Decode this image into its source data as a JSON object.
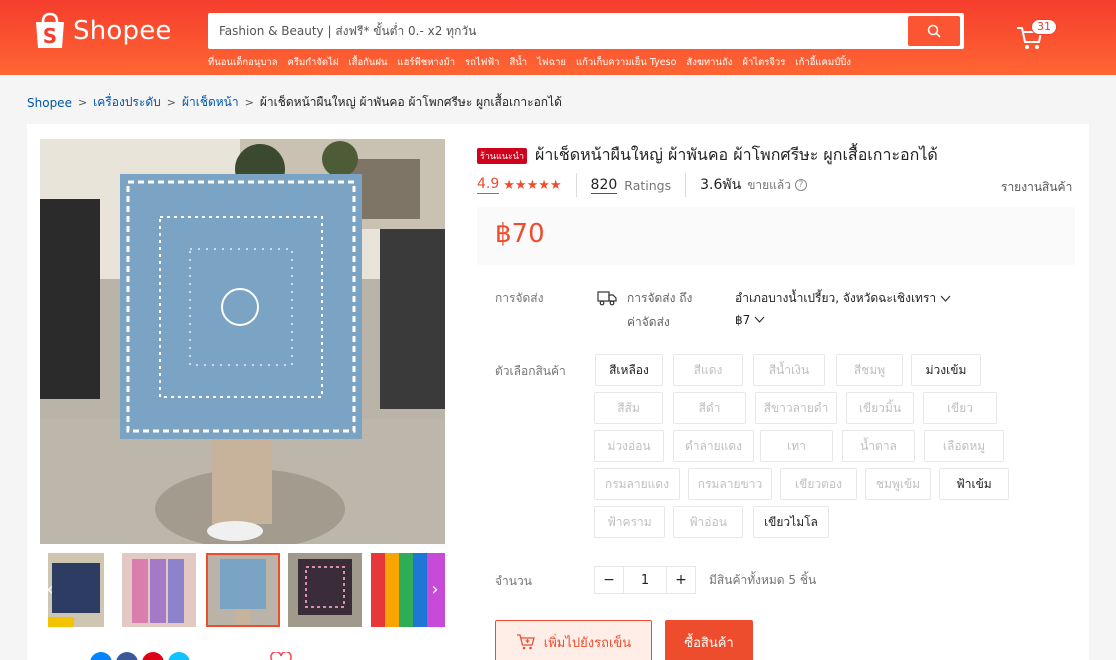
{
  "header": {
    "logo_text": "Shopee",
    "search_value": "Fashion & Beauty | ส่งฟรี* ขั้นต่ำ 0.- x2 ทุกวัน",
    "hints": [
      "ที่นอนเด็กอนุบาล",
      "ครีมกำจัดไฝ",
      "เสื้อกันฝน",
      "แฮร์พีชหางม้า",
      "รถไฟฟ้า",
      "สีน้ำ",
      "ไฟฉาย",
      "แก้วเก็บความเย็น Tyeso",
      "สังฆทานถัง",
      "ผ้าไตรจีวร",
      "เก้าอี้แคมป์ปิ้ง"
    ],
    "cart_count": "31"
  },
  "breadcrumb": {
    "items": [
      "Shopee",
      "เครื่องประดับ",
      "ผ้าเช็ดหน้า"
    ],
    "current": "ผ้าเช็ดหน้าผืนใหญ่ ผ้าพันคอ ผ้าโพกศรีษะ ผูกเสื้อเกาะอกได้"
  },
  "product": {
    "badge": "ร้านแนะนำ",
    "title": "ผ้าเช็ดหน้าผืนใหญ่ ผ้าพันคอ ผ้าโพกศรีษะ ผูกเสื้อเกาะอกได้",
    "rating": "4.9",
    "stars": "★★★★★",
    "ratings_count": "820",
    "ratings_label": "Ratings",
    "sold": "3.6พัน",
    "sold_label": "ขายแล้ว",
    "report": "รายงานสินค้า",
    "price": "฿70"
  },
  "shipping": {
    "label": "การจัดส่ง",
    "to_label": "การจัดส่ง ถึง",
    "to_value": "อำเภอบางน้ำเปรี้ยว, จังหวัดฉะเชิงเทรา",
    "fee_label": "ค่าจัดส่ง",
    "fee_value": "฿7"
  },
  "variations": {
    "label": "ตัวเลือกสินค้า",
    "options": [
      {
        "label": "สีเหลือง",
        "available": true
      },
      {
        "label": "สีแดง",
        "available": false
      },
      {
        "label": "สีน้ำเงิน",
        "available": false
      },
      {
        "label": "สีชมพู",
        "available": false
      },
      {
        "label": "ม่วงเข้ม",
        "available": true
      },
      {
        "label": "สีส้ม",
        "available": false
      },
      {
        "label": "สีดำ",
        "available": false
      },
      {
        "label": "สีขาวลายดำ",
        "available": false
      },
      {
        "label": "เขียวมิ้น",
        "available": false
      },
      {
        "label": "เขียว",
        "available": false
      },
      {
        "label": "ม่วงอ่อน",
        "available": false
      },
      {
        "label": "ดำลายแดง",
        "available": false
      },
      {
        "label": "เทา",
        "available": false
      },
      {
        "label": "น้ำตาล",
        "available": false
      },
      {
        "label": "เลือดหมู",
        "available": false
      },
      {
        "label": "กรมลายแดง",
        "available": false
      },
      {
        "label": "กรมลายขาว",
        "available": false
      },
      {
        "label": "เขียวตอง",
        "available": false
      },
      {
        "label": "ชมพูเข้ม",
        "available": false
      },
      {
        "label": "ฟ้าเข้ม",
        "available": true
      },
      {
        "label": "ฟ้าคราม",
        "available": false
      },
      {
        "label": "ฟ้าอ่อน",
        "available": false
      },
      {
        "label": "เขียวไมโล",
        "available": true
      }
    ]
  },
  "quantity": {
    "label": "จำนวน",
    "value": "1",
    "minus": "−",
    "plus": "+",
    "stock": "มีสินค้าทั้งหมด 5 ชิ้น"
  },
  "actions": {
    "add_to_cart": "เพิ่มไปยังรถเข็น",
    "buy_now": "ซื้อสินค้า"
  },
  "colors": {
    "brand": "#ee4d2d",
    "header_top": "#f53d2d",
    "header_bottom": "#ff6633"
  }
}
